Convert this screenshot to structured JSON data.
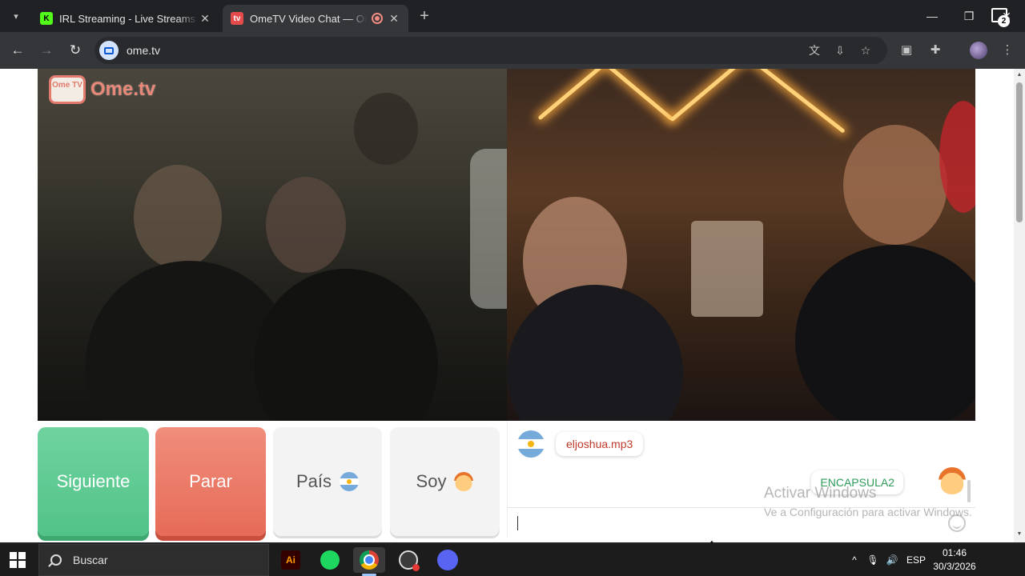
{
  "browser": {
    "tabs": [
      {
        "title": "IRL Streaming - Live Streams on",
        "favicon": "kick-icon",
        "active": false
      },
      {
        "title": "OmeTV Video Chat — Ome",
        "favicon": "ometv-icon",
        "active": true,
        "recording": true
      }
    ],
    "address": "ome.tv"
  },
  "page": {
    "logo": {
      "tv_text": "Ome TV",
      "brand": "Ome.tv"
    },
    "buttons": {
      "next": "Siguiente",
      "stop": "Parar",
      "country": "País",
      "gender": "Soy"
    },
    "chat": {
      "incoming": {
        "text": "eljoshua.mp3",
        "country": "argentina-flag"
      },
      "outgoing": {
        "text": "ENCAPSULA2",
        "avatar": "boy-emoji"
      },
      "input_value": ""
    }
  },
  "watermark": {
    "line1": "Activar Windows",
    "line2": "Ve a Configuración para activar Windows."
  },
  "taskbar": {
    "search_placeholder": "Buscar",
    "lang": "ESP",
    "time": "01:46",
    "date": "30/3/2026",
    "notification_count": "2",
    "apps": [
      "adobe-illustrator-icon",
      "spotify-icon",
      "chrome-icon",
      "obs-icon",
      "discord-icon"
    ]
  },
  "colors": {
    "next": "#52c388",
    "stop": "#e66b58",
    "incoming_text": "#c0392b",
    "outgoing_text": "#2e9a5a"
  }
}
